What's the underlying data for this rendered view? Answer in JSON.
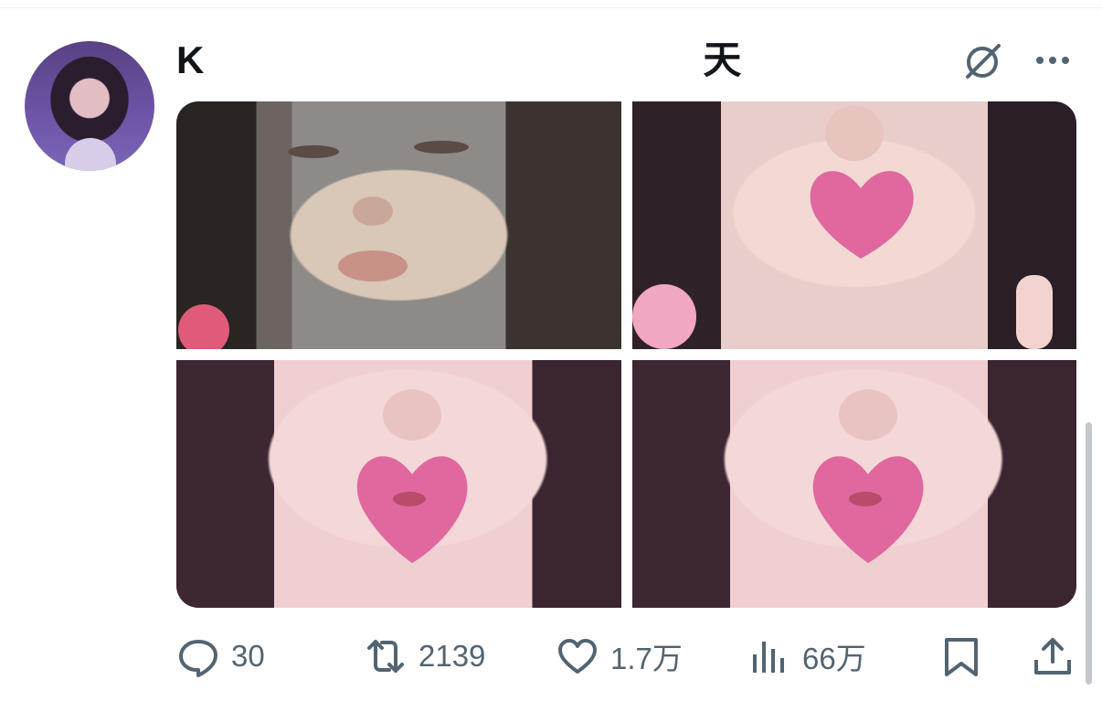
{
  "tweet": {
    "display_name": "K",
    "display_name_suffix": "天"
  },
  "media": {
    "images": [
      {
        "alt": "photo-1"
      },
      {
        "alt": "photo-2"
      },
      {
        "alt": "photo-3"
      },
      {
        "alt": "photo-4"
      }
    ]
  },
  "actions": {
    "replies": "30",
    "retweets": "2139",
    "likes": "1.7万",
    "views": "66万"
  },
  "icons": {
    "reply": "reply-bubble-icon",
    "retweet": "retweet-icon",
    "like": "heart-icon",
    "views": "analytics-bars-icon",
    "bookmark": "bookmark-icon",
    "share": "share-upload-icon",
    "grok": "grok-icon",
    "more": "more-dots-icon"
  },
  "colors": {
    "text_primary": "#0f1419",
    "text_secondary": "#536471",
    "lip_pink": "#e0689f"
  }
}
